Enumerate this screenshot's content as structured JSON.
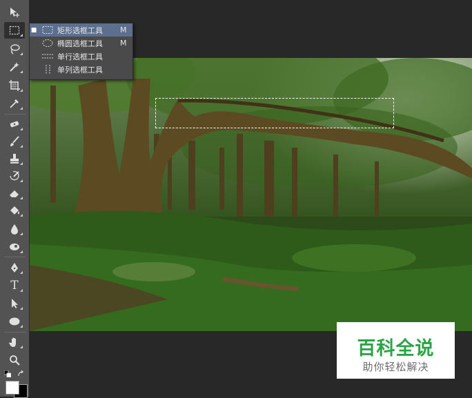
{
  "colors": {
    "toolbar_bg": "#535353",
    "flyout_highlight": "#5c6f8f",
    "watermark_green": "#2aa444"
  },
  "toolbar": {
    "tools": [
      {
        "name": "move-tool",
        "icon": "move-icon"
      },
      {
        "name": "rectangular-marquee-tool",
        "icon": "marquee-rect-icon",
        "active": true
      },
      {
        "name": "lasso-tool",
        "icon": "lasso-icon"
      },
      {
        "name": "magic-wand-tool",
        "icon": "magic-wand-icon"
      },
      {
        "name": "crop-tool",
        "icon": "crop-icon"
      },
      {
        "name": "eyedropper-tool",
        "icon": "eyedropper-icon"
      },
      {
        "name": "spot-healing-tool",
        "icon": "bandage-icon"
      },
      {
        "name": "brush-tool",
        "icon": "brush-icon"
      },
      {
        "name": "clone-stamp-tool",
        "icon": "stamp-icon"
      },
      {
        "name": "history-brush-tool",
        "icon": "history-brush-icon"
      },
      {
        "name": "eraser-tool",
        "icon": "eraser-icon"
      },
      {
        "name": "paint-bucket-tool",
        "icon": "paint-bucket-icon"
      },
      {
        "name": "blur-tool",
        "icon": "drop-icon"
      },
      {
        "name": "dodge-tool",
        "icon": "dodge-icon"
      },
      {
        "name": "pen-tool",
        "icon": "pen-icon"
      },
      {
        "name": "type-tool",
        "icon": "type-icon"
      },
      {
        "name": "path-selection-tool",
        "icon": "arrow-icon"
      },
      {
        "name": "ellipse-tool",
        "icon": "ellipse-icon"
      },
      {
        "name": "hand-tool",
        "icon": "hand-icon"
      },
      {
        "name": "zoom-tool",
        "icon": "zoom-icon"
      }
    ],
    "type_glyph": "T"
  },
  "flyout": {
    "items": [
      {
        "label": "矩形选框工具",
        "shortcut": "M",
        "selected": true,
        "icon": "marquee-rect-icon"
      },
      {
        "label": "椭圆选框工具",
        "shortcut": "M",
        "selected": false,
        "icon": "marquee-ellipse-icon"
      },
      {
        "label": "单行选框工具",
        "shortcut": "",
        "selected": false,
        "icon": "single-row-icon"
      },
      {
        "label": "单列选框工具",
        "shortcut": "",
        "selected": false,
        "icon": "single-column-icon"
      }
    ],
    "selected_bullet": "■"
  },
  "watermark": {
    "title": "百科全说",
    "subtitle": "助你轻松解决"
  },
  "swatches": {
    "foreground": "#ffffff",
    "background": "#000000"
  }
}
